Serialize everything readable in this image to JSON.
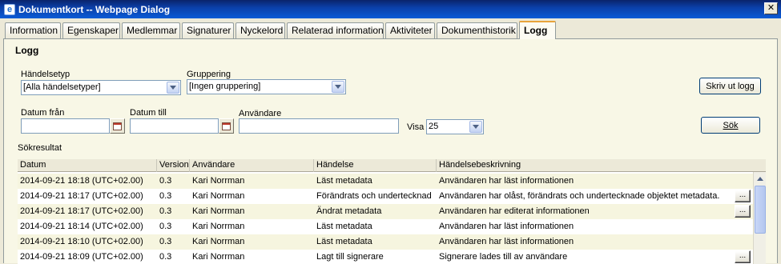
{
  "window": {
    "title": "Dokumentkort -- Webpage Dialog",
    "close_label": "✕"
  },
  "tabs": [
    {
      "label": "Information"
    },
    {
      "label": "Egenskaper"
    },
    {
      "label": "Medlemmar"
    },
    {
      "label": "Signaturer"
    },
    {
      "label": "Nyckelord"
    },
    {
      "label": "Relaterad information"
    },
    {
      "label": "Aktiviteter"
    },
    {
      "label": "Dokumenthistorik"
    },
    {
      "label": "Logg",
      "active": true
    }
  ],
  "logg": {
    "section_title": "Logg",
    "event_type_label": "Händelsetyp",
    "event_type_value": "[Alla händelsetyper]",
    "grouping_label": "Gruppering",
    "grouping_value": "[Ingen gruppering]",
    "print_button": "Skriv ut logg",
    "date_from_label": "Datum från",
    "date_from_value": "",
    "date_to_label": "Datum till",
    "date_to_value": "",
    "user_label": "Användare",
    "user_value": "",
    "show_label": "Visa",
    "show_value": "25",
    "search_button": "Sök",
    "results_label": "Sökresultat"
  },
  "table": {
    "columns": [
      "Datum",
      "Version",
      "Användare",
      "Händelse",
      "Händelsebeskrivning"
    ],
    "rows": [
      {
        "date": "2014-09-21 18:18 (UTC+02.00)",
        "version": "0.3",
        "user": "Kari Norrman",
        "event": "Läst metadata",
        "description": "Användaren har läst informationen",
        "more": false
      },
      {
        "date": "2014-09-21 18:17 (UTC+02.00)",
        "version": "0.3",
        "user": "Kari Norrman",
        "event": "Förändrats och undertecknad",
        "description": "Användaren har olåst, förändrats och undertecknade objektet metadata.",
        "more": true
      },
      {
        "date": "2014-09-21 18:17 (UTC+02.00)",
        "version": "0.3",
        "user": "Kari Norrman",
        "event": "Ändrat metadata",
        "description": "Användaren har editerat informationen",
        "more": true
      },
      {
        "date": "2014-09-21 18:14 (UTC+02.00)",
        "version": "0.3",
        "user": "Kari Norrman",
        "event": "Läst metadata",
        "description": "Användaren har läst informationen",
        "more": false
      },
      {
        "date": "2014-09-21 18:10 (UTC+02.00)",
        "version": "0.3",
        "user": "Kari Norrman",
        "event": "Läst metadata",
        "description": "Användaren har läst informationen",
        "more": false
      },
      {
        "date": "2014-09-21 18:09 (UTC+02.00)",
        "version": "0.3",
        "user": "Kari Norrman",
        "event": "Lagt till signerare",
        "description": "Signerare lades till av användare",
        "more": true
      }
    ],
    "more_label": "..."
  }
}
